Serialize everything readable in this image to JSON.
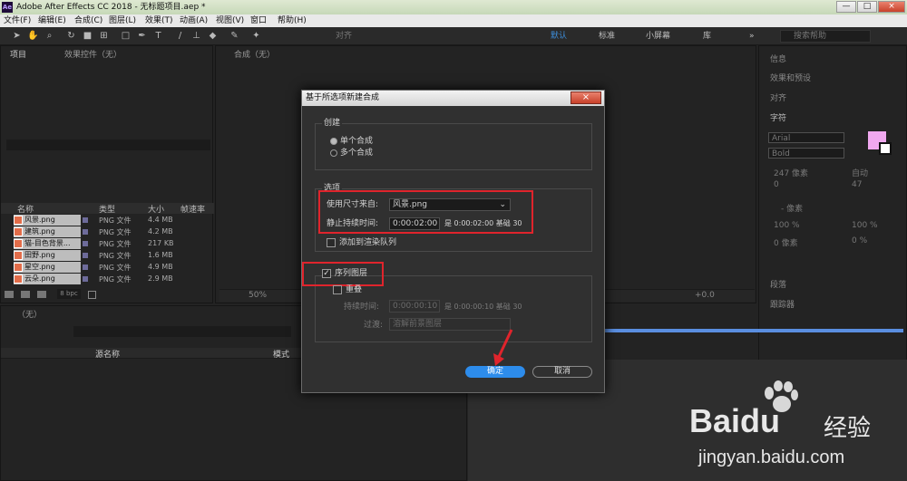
{
  "window": {
    "title": "Adobe After Effects CC 2018 - 无标题项目.aep *",
    "app_icon": "Ae",
    "min": "—",
    "max": "□",
    "close": "×"
  },
  "menu": [
    "文件(F)",
    "编辑(E)",
    "合成(C)",
    "图层(L)",
    "效果(T)",
    "动画(A)",
    "视图(V)",
    "窗口",
    "帮助(H)"
  ],
  "toolbar": {
    "snap": "对齐",
    "workspaces": [
      "默认",
      "标准",
      "小屏幕",
      "库"
    ],
    "active_workspace": "默认",
    "search_placeholder": "搜索帮助"
  },
  "project": {
    "tab": "项目",
    "tab2": "效果控件（无）",
    "columns": [
      "名称",
      "类型",
      "大小",
      "帧速率"
    ],
    "items": [
      {
        "name": "风景.png",
        "type": "PNG 文件",
        "size": "4.4 MB"
      },
      {
        "name": "建筑.png",
        "type": "PNG 文件",
        "size": "4.2 MB"
      },
      {
        "name": "猫-目色背景...",
        "type": "PNG 文件",
        "size": "217 KB"
      },
      {
        "name": "田野.png",
        "type": "PNG 文件",
        "size": "1.6 MB"
      },
      {
        "name": "星空.png",
        "type": "PNG 文件",
        "size": "4.9 MB"
      },
      {
        "name": "云朵.png",
        "type": "PNG 文件",
        "size": "2.9 MB"
      }
    ],
    "bpc": "8 bpc"
  },
  "comp": {
    "tab": "合成（无）",
    "zoom": "50%",
    "offset": "+0.0"
  },
  "right": {
    "panels": [
      "信息",
      "效果和预设",
      "对齐",
      "字符",
      "段落",
      "跟踪器"
    ],
    "font": "Arial",
    "style": "Bold",
    "leading": "自动",
    "tracking": "47",
    "size_label": "247 像素",
    "zero": "0",
    "unit": "- 像素",
    "scale_v": "100 %",
    "scale_h": "100 %",
    "baseline": "0 像素",
    "tsume": "0 %"
  },
  "timeline": {
    "tab": "（无）",
    "col_source": "源名称",
    "col_mode": "模式"
  },
  "dialog": {
    "title": "基于所选项新建合成",
    "close": "×",
    "create_group": "创建",
    "radio_single": "单个合成",
    "radio_multi": "多个合成",
    "options_group": "选项",
    "use_dims_label": "使用尺寸来自:",
    "use_dims_value": "风景.png",
    "still_duration_label": "静止持续时间:",
    "still_duration_value": "0:00:02:00",
    "still_duration_info": "是 0:00:02:00  基础 30",
    "add_render_queue": "添加到渲染队列",
    "sequence_layers": "序列图层",
    "overlap": "重叠",
    "duration_label": "持续时间:",
    "duration_value": "0:00:00:10",
    "duration_info": "是 0:00:00:10  基础 30",
    "transition_label": "过渡:",
    "transition_value": "溶解前景图层",
    "ok": "确定",
    "cancel": "取消"
  },
  "watermark": {
    "logo": "Bai",
    "logo2": "du",
    "brand": "经验",
    "url": "jingyan.baidu.com"
  }
}
